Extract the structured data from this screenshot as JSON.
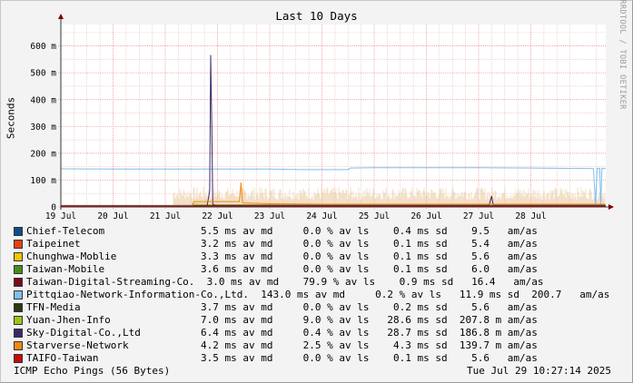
{
  "chart_data": {
    "type": "line",
    "title": "Last 10 Days",
    "ylabel": "Seconds",
    "xlabel": "",
    "watermark": "RRDTOOL / TOBI OETIKER",
    "xlim": [
      "2025-07-19",
      "2025-07-29T10:27"
    ],
    "ylim": [
      0,
      0.68
    ],
    "grid": true,
    "x_ticks": [
      "19 Jul",
      "20 Jul",
      "21 Jul",
      "22 Jul",
      "23 Jul",
      "24 Jul",
      "25 Jul",
      "26 Jul",
      "27 Jul",
      "28 Jul"
    ],
    "y_ticks": [
      {
        "value": 0,
        "label": "0"
      },
      {
        "value": 0.1,
        "label": "100 m"
      },
      {
        "value": 0.2,
        "label": "200 m"
      },
      {
        "value": 0.3,
        "label": "300 m"
      },
      {
        "value": 0.4,
        "label": "400 m"
      },
      {
        "value": 0.5,
        "label": "500 m"
      },
      {
        "value": 0.6,
        "label": "600 m"
      }
    ],
    "series": [
      {
        "name": "Chief-Telecom",
        "color": "#0b4f8a",
        "stats": "5.5 ms av md     0.0 % av ls    0.4 ms sd    9.5   am/as",
        "values": [
          [
            0.0,
            0.0055
          ],
          [
            10.43,
            0.0055
          ]
        ]
      },
      {
        "name": "Taipeinet",
        "color": "#e8401a",
        "stats": "3.2 ms av md     0.0 % av ls    0.1 ms sd    5.4   am/as",
        "values": [
          [
            0.0,
            0.0032
          ],
          [
            10.43,
            0.0032
          ]
        ]
      },
      {
        "name": "Chunghwa-Moblie",
        "color": "#f2c500",
        "stats": "3.3 ms av md     0.0 % av ls    0.1 ms sd    5.6   am/as",
        "values": [
          [
            0.0,
            0.0033
          ],
          [
            10.43,
            0.0033
          ]
        ]
      },
      {
        "name": "Taiwan-Mobile",
        "color": "#4a8a20",
        "stats": "3.6 ms av md     0.0 % av ls    0.1 ms sd    6.0   am/as",
        "values": [
          [
            0.0,
            0.0036
          ],
          [
            10.43,
            0.0036
          ]
        ]
      },
      {
        "name": "Taiwan-Digital-Streaming-Co.",
        "color": "#7a0a1e",
        "stats": "3.0 ms av md    79.9 % av ls    0.9 ms sd   16.4   am/as",
        "values": [
          [
            0.0,
            0.003
          ],
          [
            2.5,
            0.003
          ],
          [
            2.82,
            0.004
          ],
          [
            3.0,
            0.004
          ],
          [
            10.43,
            0.004
          ]
        ]
      },
      {
        "name": "Pittqiao-Network-Information-Co.,Ltd.",
        "color": "#7fbfee",
        "stats": "143.0 ms av md     0.2 % av ls   11.9 ms sd  200.7   am/as",
        "values": [
          [
            0.0,
            0.142
          ],
          [
            1.0,
            0.141
          ],
          [
            2.0,
            0.141
          ],
          [
            3.0,
            0.141
          ],
          [
            4.0,
            0.141
          ],
          [
            4.6,
            0.139
          ],
          [
            5.0,
            0.139
          ],
          [
            5.5,
            0.139
          ],
          [
            5.55,
            0.145
          ],
          [
            6.0,
            0.146
          ],
          [
            7.0,
            0.146
          ],
          [
            8.0,
            0.146
          ],
          [
            9.0,
            0.145
          ],
          [
            9.5,
            0.144
          ],
          [
            10.2,
            0.143
          ],
          [
            10.24,
            0.0
          ],
          [
            10.27,
            0.144
          ],
          [
            10.32,
            0.144
          ],
          [
            10.34,
            0.0
          ],
          [
            10.36,
            0.144
          ],
          [
            10.43,
            0.143
          ]
        ]
      },
      {
        "name": "TFN-Media",
        "color": "#2a3a10",
        "stats": "3.7 ms av md     0.0 % av ls    0.2 ms sd    5.6   am/as",
        "values": [
          [
            0.0,
            0.0037
          ],
          [
            10.43,
            0.0037
          ]
        ]
      },
      {
        "name": "Yuan-Jhen-Info",
        "color": "#98c81a",
        "stats": "7.0 ms av md     9.0 % av ls   28.6 ms sd  207.8 m am/as",
        "values": [
          [
            0.0,
            0.005
          ],
          [
            2.5,
            0.005
          ],
          [
            2.55,
            0.01
          ],
          [
            3.0,
            0.008
          ],
          [
            4.0,
            0.008
          ],
          [
            5.0,
            0.008
          ],
          [
            6.0,
            0.008
          ],
          [
            7.0,
            0.008
          ],
          [
            8.0,
            0.008
          ],
          [
            9.0,
            0.008
          ],
          [
            10.43,
            0.008
          ]
        ]
      },
      {
        "name": "Sky-Digital-Co.,Ltd",
        "color": "#3a2868",
        "stats": "6.4 ms av md     0.4 % av ls   28.7 ms sd  186.8 m am/as",
        "values": [
          [
            0.0,
            0.004
          ],
          [
            2.8,
            0.004
          ],
          [
            2.85,
            0.06
          ],
          [
            2.87,
            0.565
          ],
          [
            2.89,
            0.3
          ],
          [
            2.91,
            0.01
          ],
          [
            2.95,
            0.006
          ],
          [
            8.2,
            0.006
          ],
          [
            8.25,
            0.04
          ],
          [
            8.28,
            0.006
          ],
          [
            10.43,
            0.006
          ]
        ]
      },
      {
        "name": "Starverse-Network",
        "color": "#f08a10",
        "stats": "4.2 ms av md     2.5 % av ls    4.3 ms sd  139.7 m am/as",
        "values": [
          [
            0.0,
            0.003
          ],
          [
            2.5,
            0.003
          ],
          [
            2.55,
            0.02
          ],
          [
            3.0,
            0.02
          ],
          [
            3.42,
            0.02
          ],
          [
            3.45,
            0.09
          ],
          [
            3.48,
            0.015
          ],
          [
            4.0,
            0.012
          ],
          [
            5.0,
            0.01
          ],
          [
            6.0,
            0.01
          ],
          [
            7.0,
            0.01
          ],
          [
            8.0,
            0.01
          ],
          [
            9.0,
            0.01
          ],
          [
            10.43,
            0.01
          ]
        ]
      },
      {
        "name": "TAIFO-Taiwan",
        "color": "#c80a0a",
        "stats": "3.5 ms av md     0.0 % av ls    0.1 ms sd    5.6   am/as",
        "values": [
          [
            0.0,
            0.0035
          ],
          [
            10.43,
            0.0035
          ]
        ]
      }
    ],
    "footer_left": "ICMP Echo Pings (56 Bytes)",
    "footer_right": "Tue Jul 29 10:27:14 2025"
  }
}
